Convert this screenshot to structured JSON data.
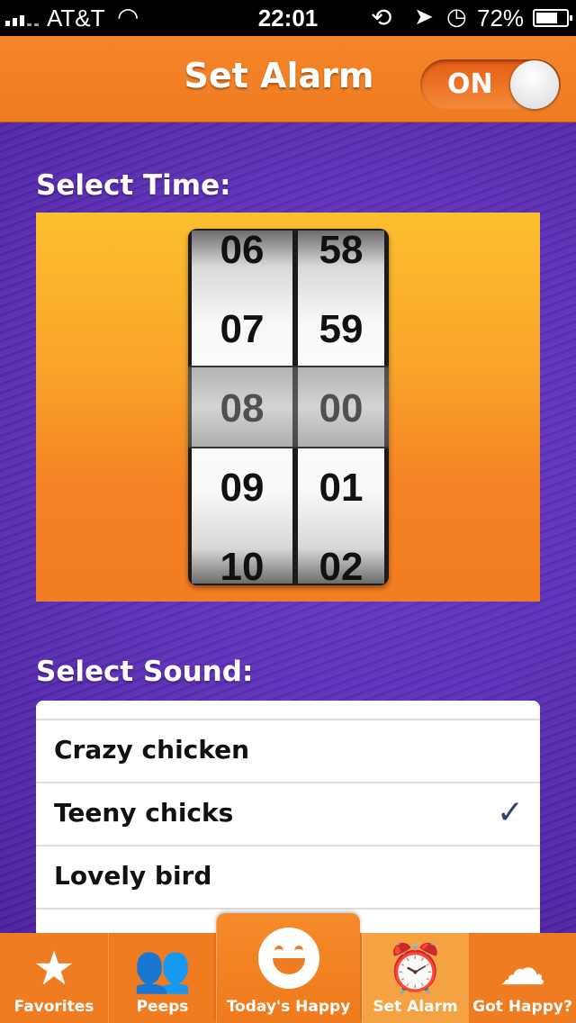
{
  "status_bar": {
    "carrier": "AT&T",
    "time": "22:01",
    "battery_percent": "72%",
    "battery_level": 0.72,
    "icons": [
      "signal-icon",
      "wifi-icon",
      "rotation-lock-icon",
      "location-arrow-icon",
      "alarm-clock-icon",
      "battery-icon"
    ]
  },
  "header": {
    "title": "Set Alarm",
    "toggle_label": "ON",
    "toggle_on": true
  },
  "time_section": {
    "label": "Select Time:",
    "hours": [
      "06",
      "07",
      "08",
      "09",
      "10"
    ],
    "minutes": [
      "58",
      "59",
      "00",
      "01",
      "02"
    ],
    "selected_hour": "08",
    "selected_minute": "00"
  },
  "sound_section": {
    "label": "Select Sound:",
    "items": [
      {
        "name": "Crazy chicken",
        "selected": false
      },
      {
        "name": "Teeny chicks",
        "selected": true
      },
      {
        "name": "Lovely bird",
        "selected": false
      }
    ],
    "check_glyph": "✓"
  },
  "tabbar": {
    "tabs": [
      {
        "label": "Favorites",
        "icon": "star-icon",
        "active": false
      },
      {
        "label": "Peeps",
        "icon": "people-icon",
        "active": false
      },
      {
        "label": "Today's Happy",
        "icon": "smiley-icon",
        "active": false
      },
      {
        "label": "Set Alarm",
        "icon": "alarm-clock-icon",
        "active": true
      },
      {
        "label": "Got Happy?",
        "icon": "cloud-upload-icon",
        "active": false
      }
    ]
  },
  "colors": {
    "orange": "#f07c22",
    "purple": "#5a2cb4",
    "check": "#2e3f73"
  }
}
